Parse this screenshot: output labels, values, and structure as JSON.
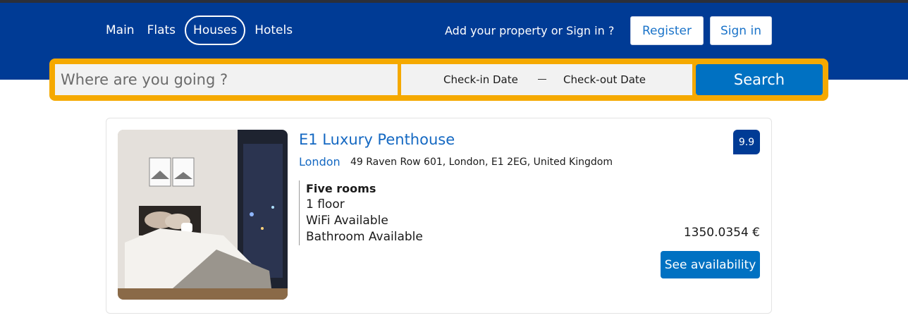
{
  "nav": {
    "items": [
      {
        "label": "Main"
      },
      {
        "label": "Flats"
      },
      {
        "label": "Houses",
        "active": true
      },
      {
        "label": "Hotels"
      }
    ]
  },
  "header": {
    "promo_text": "Add your property or Sign in ?",
    "register_label": "Register",
    "signin_label": "Sign in"
  },
  "search": {
    "destination_placeholder": "Where are you going ?",
    "checkin_label": "Check-in Date",
    "checkout_label": "Check-out Date",
    "button_label": "Search"
  },
  "listing": {
    "title": "E1 Luxury Penthouse",
    "city": "London",
    "address": "49 Raven Row 601, London, E1 2EG, United Kingdom",
    "score": "9.9",
    "features": [
      "Five rooms",
      "1 floor",
      "WiFi Available",
      "Bathroom Available"
    ],
    "price": "1350.0354 €",
    "availability_label": "See availability"
  },
  "colors": {
    "header_bg": "#003b95",
    "search_border": "#f5a900",
    "primary_button": "#0071c2",
    "link": "#1468c2"
  }
}
